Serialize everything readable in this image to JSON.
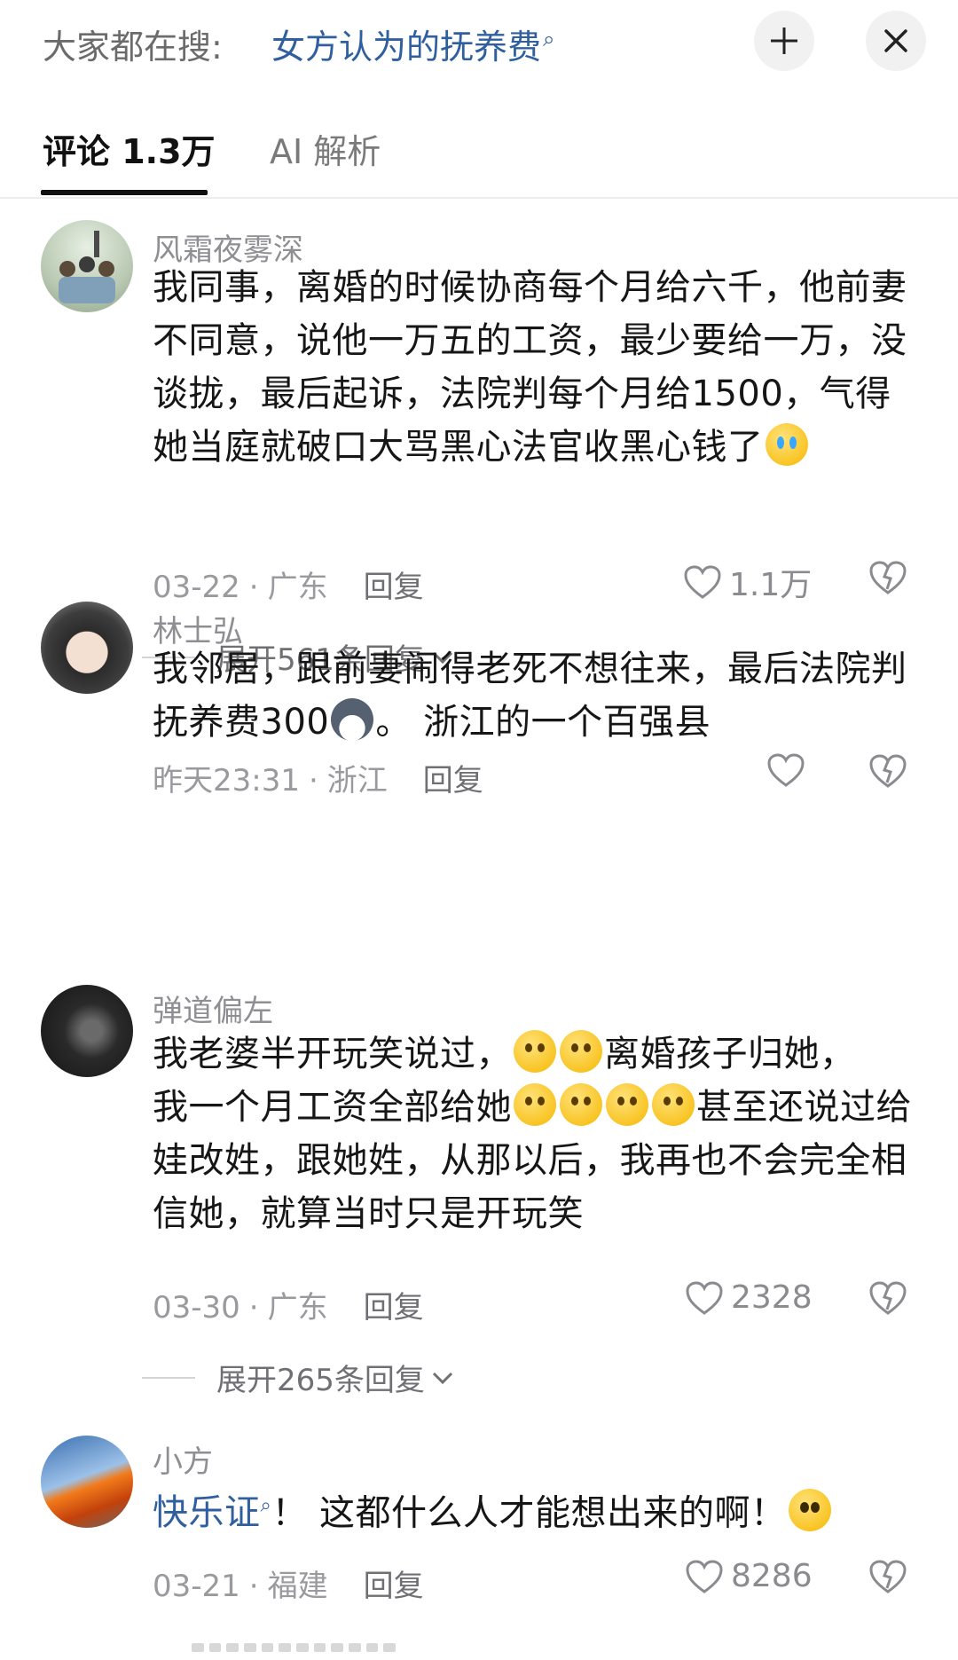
{
  "header": {
    "search_prefix": "大家都在搜:",
    "search_term": "女方认为的抚养费",
    "search_icon": "search-icon",
    "buttons": [
      {
        "icon": "minimize-icon"
      },
      {
        "icon": "close-icon"
      }
    ]
  },
  "tabs": [
    {
      "label": "评论 1.3万",
      "active": true
    },
    {
      "label": "AI 解析",
      "active": false
    }
  ],
  "comments": [
    {
      "username": "风霜夜雾深",
      "text": "我同事，离婚的时候协商每个月给六千，他前妻不同意，说他一万五的工资，最少要给一万，没谈拢，最后起诉，法院判每个月给1500，气得她当庭就破口大骂黑心法官收黑心钱了",
      "date": "03-22",
      "location": "广东",
      "reply_label": "回复",
      "likes": "1.1万",
      "expand_label": "展开561条回复"
    },
    {
      "username": "林士弘",
      "text_part1": "我邻居，跟前妻闹得老死不想往来，最后法院判抚养费300",
      "text_part2": "。 浙江的一个百强县",
      "date": "昨天23:31",
      "location": "浙江",
      "reply_label": "回复",
      "likes": ""
    },
    {
      "username": "弹道偏左",
      "text_part1": "我老婆半开玩笑说过，",
      "text_part2": "离婚孩子归她，",
      "text_part3": "我一个月工资全部给她",
      "text_part4": "甚至还说过给娃改姓，跟她姓，从那以后，我再也不会完全相信她，就算当时只是开玩笑",
      "date": "03-30",
      "location": "广东",
      "reply_label": "回复",
      "likes": "2328",
      "expand_label": "展开265条回复"
    },
    {
      "username": "小方",
      "link_text": "快乐证",
      "text_part1": "！  这都什么人才能想出来的啊！",
      "date": "03-21",
      "location": "福建",
      "reply_label": "回复",
      "likes": "8286"
    }
  ],
  "colors": {
    "link": "#2f5f9e",
    "meta": "#9a9a9e",
    "text": "#161616"
  }
}
